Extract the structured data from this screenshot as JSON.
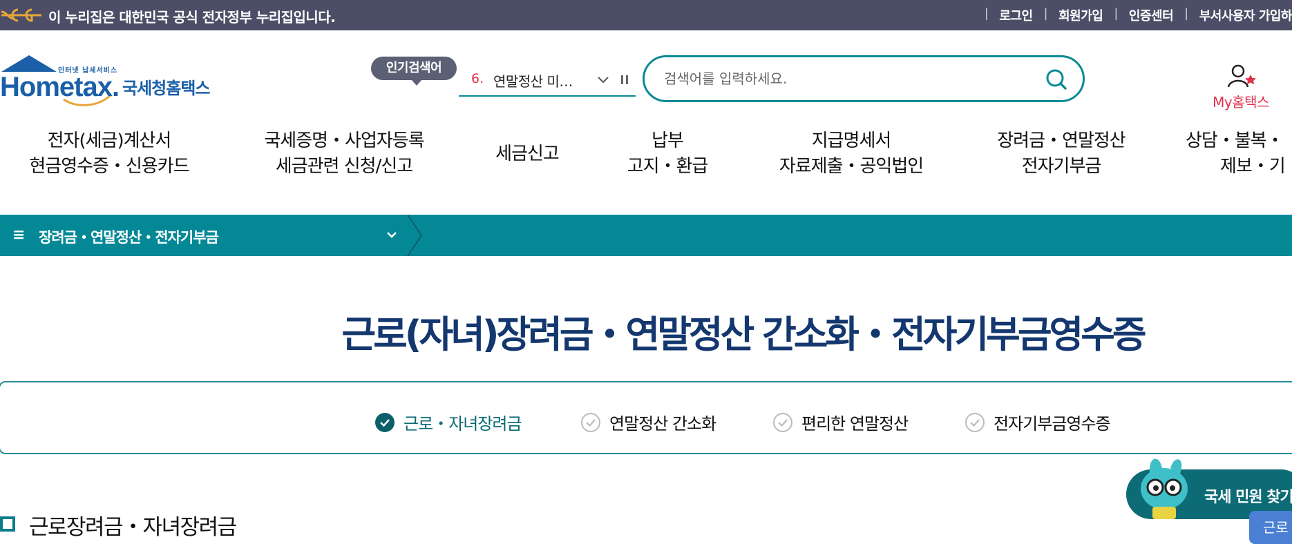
{
  "gov_bar": {
    "notice": "이 누리집은 대한민국 공식 전자정부 누리집입니다.",
    "links": [
      "로그인",
      "회원가입",
      "인증센터",
      "부서사용자 가입하"
    ]
  },
  "logo": {
    "sub": "인터넷 납세서비스",
    "main": "Hometax.",
    "kr": "국세청홈택스"
  },
  "popular": {
    "badge": "인기검색어",
    "rank": "6.",
    "text": "연말정산 미…"
  },
  "search": {
    "placeholder": "검색어를 입력하세요."
  },
  "myhome": {
    "label": "My홈택스"
  },
  "gnb": [
    {
      "line1": "전자(세금)계산서",
      "line2": "현금영수증・신용카드"
    },
    {
      "line1": "국세증명・사업자등록",
      "line2": "세금관련 신청/신고"
    },
    {
      "line1": "세금신고",
      "line2": ""
    },
    {
      "line1": "납부",
      "line2": "고지・환급"
    },
    {
      "line1": "지급명세서",
      "line2": "자료제출・공익법인"
    },
    {
      "line1": "장려금・연말정산",
      "line2": "전자기부금"
    },
    {
      "line1": "상담・불복・",
      "line2": "제보・기"
    }
  ],
  "path_bar": {
    "menu_icon": "≡",
    "label": "장려금・연말정산・전자기부금"
  },
  "page_title": "근로(자녀)장려금・연말정산 간소화・전자기부금영수증",
  "tabs": [
    {
      "label": "근로・자녀장려금",
      "active": true
    },
    {
      "label": "연말정산 간소화",
      "active": false
    },
    {
      "label": "편리한 연말정산",
      "active": false
    },
    {
      "label": "전자기부금영수증",
      "active": false
    }
  ],
  "section_title": "근로장려금・자녀장려금",
  "minwon": {
    "label": "국세 민원 찾기"
  },
  "blue_button": {
    "label": "근로"
  },
  "colors": {
    "teal": "#058896",
    "navy": "#13376e",
    "red": "#e3324a",
    "gov_bar": "#4b4e66"
  }
}
